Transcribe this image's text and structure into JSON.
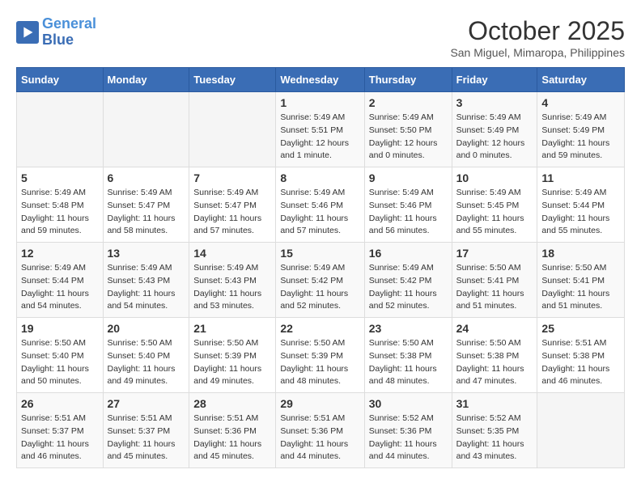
{
  "logo": {
    "line1": "General",
    "line2": "Blue"
  },
  "title": "October 2025",
  "location": "San Miguel, Mimaropa, Philippines",
  "days_of_week": [
    "Sunday",
    "Monday",
    "Tuesday",
    "Wednesday",
    "Thursday",
    "Friday",
    "Saturday"
  ],
  "weeks": [
    [
      {
        "day": "",
        "info": ""
      },
      {
        "day": "",
        "info": ""
      },
      {
        "day": "",
        "info": ""
      },
      {
        "day": "1",
        "info": "Sunrise: 5:49 AM\nSunset: 5:51 PM\nDaylight: 12 hours and 1 minute."
      },
      {
        "day": "2",
        "info": "Sunrise: 5:49 AM\nSunset: 5:50 PM\nDaylight: 12 hours and 0 minutes."
      },
      {
        "day": "3",
        "info": "Sunrise: 5:49 AM\nSunset: 5:49 PM\nDaylight: 12 hours and 0 minutes."
      },
      {
        "day": "4",
        "info": "Sunrise: 5:49 AM\nSunset: 5:49 PM\nDaylight: 11 hours and 59 minutes."
      }
    ],
    [
      {
        "day": "5",
        "info": "Sunrise: 5:49 AM\nSunset: 5:48 PM\nDaylight: 11 hours and 59 minutes."
      },
      {
        "day": "6",
        "info": "Sunrise: 5:49 AM\nSunset: 5:47 PM\nDaylight: 11 hours and 58 minutes."
      },
      {
        "day": "7",
        "info": "Sunrise: 5:49 AM\nSunset: 5:47 PM\nDaylight: 11 hours and 57 minutes."
      },
      {
        "day": "8",
        "info": "Sunrise: 5:49 AM\nSunset: 5:46 PM\nDaylight: 11 hours and 57 minutes."
      },
      {
        "day": "9",
        "info": "Sunrise: 5:49 AM\nSunset: 5:46 PM\nDaylight: 11 hours and 56 minutes."
      },
      {
        "day": "10",
        "info": "Sunrise: 5:49 AM\nSunset: 5:45 PM\nDaylight: 11 hours and 55 minutes."
      },
      {
        "day": "11",
        "info": "Sunrise: 5:49 AM\nSunset: 5:44 PM\nDaylight: 11 hours and 55 minutes."
      }
    ],
    [
      {
        "day": "12",
        "info": "Sunrise: 5:49 AM\nSunset: 5:44 PM\nDaylight: 11 hours and 54 minutes."
      },
      {
        "day": "13",
        "info": "Sunrise: 5:49 AM\nSunset: 5:43 PM\nDaylight: 11 hours and 54 minutes."
      },
      {
        "day": "14",
        "info": "Sunrise: 5:49 AM\nSunset: 5:43 PM\nDaylight: 11 hours and 53 minutes."
      },
      {
        "day": "15",
        "info": "Sunrise: 5:49 AM\nSunset: 5:42 PM\nDaylight: 11 hours and 52 minutes."
      },
      {
        "day": "16",
        "info": "Sunrise: 5:49 AM\nSunset: 5:42 PM\nDaylight: 11 hours and 52 minutes."
      },
      {
        "day": "17",
        "info": "Sunrise: 5:50 AM\nSunset: 5:41 PM\nDaylight: 11 hours and 51 minutes."
      },
      {
        "day": "18",
        "info": "Sunrise: 5:50 AM\nSunset: 5:41 PM\nDaylight: 11 hours and 51 minutes."
      }
    ],
    [
      {
        "day": "19",
        "info": "Sunrise: 5:50 AM\nSunset: 5:40 PM\nDaylight: 11 hours and 50 minutes."
      },
      {
        "day": "20",
        "info": "Sunrise: 5:50 AM\nSunset: 5:40 PM\nDaylight: 11 hours and 49 minutes."
      },
      {
        "day": "21",
        "info": "Sunrise: 5:50 AM\nSunset: 5:39 PM\nDaylight: 11 hours and 49 minutes."
      },
      {
        "day": "22",
        "info": "Sunrise: 5:50 AM\nSunset: 5:39 PM\nDaylight: 11 hours and 48 minutes."
      },
      {
        "day": "23",
        "info": "Sunrise: 5:50 AM\nSunset: 5:38 PM\nDaylight: 11 hours and 48 minutes."
      },
      {
        "day": "24",
        "info": "Sunrise: 5:50 AM\nSunset: 5:38 PM\nDaylight: 11 hours and 47 minutes."
      },
      {
        "day": "25",
        "info": "Sunrise: 5:51 AM\nSunset: 5:38 PM\nDaylight: 11 hours and 46 minutes."
      }
    ],
    [
      {
        "day": "26",
        "info": "Sunrise: 5:51 AM\nSunset: 5:37 PM\nDaylight: 11 hours and 46 minutes."
      },
      {
        "day": "27",
        "info": "Sunrise: 5:51 AM\nSunset: 5:37 PM\nDaylight: 11 hours and 45 minutes."
      },
      {
        "day": "28",
        "info": "Sunrise: 5:51 AM\nSunset: 5:36 PM\nDaylight: 11 hours and 45 minutes."
      },
      {
        "day": "29",
        "info": "Sunrise: 5:51 AM\nSunset: 5:36 PM\nDaylight: 11 hours and 44 minutes."
      },
      {
        "day": "30",
        "info": "Sunrise: 5:52 AM\nSunset: 5:36 PM\nDaylight: 11 hours and 44 minutes."
      },
      {
        "day": "31",
        "info": "Sunrise: 5:52 AM\nSunset: 5:35 PM\nDaylight: 11 hours and 43 minutes."
      },
      {
        "day": "",
        "info": ""
      }
    ]
  ]
}
